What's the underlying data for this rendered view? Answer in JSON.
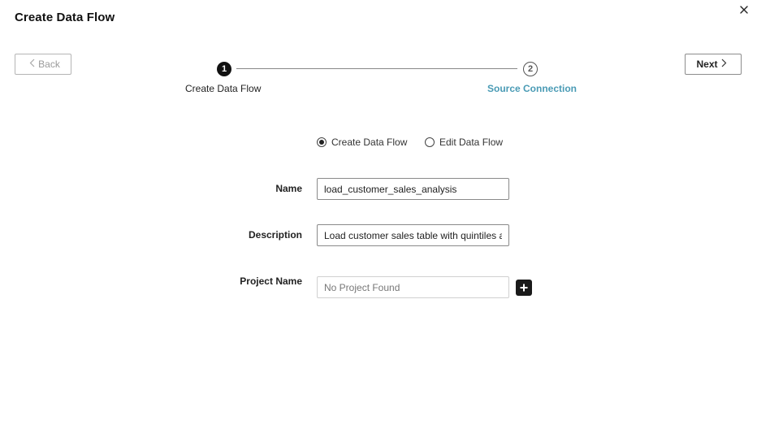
{
  "dialog": {
    "title": "Create Data Flow",
    "close_icon": "close-icon"
  },
  "nav": {
    "back_label": "Back",
    "next_label": "Next"
  },
  "stepper": {
    "steps": [
      {
        "number": "1",
        "label": "Create Data Flow",
        "state": "active"
      },
      {
        "number": "2",
        "label": "Source Connection",
        "state": "upcoming"
      }
    ],
    "upcoming_color": "#4a9bb5"
  },
  "mode": {
    "options": [
      {
        "label": "Create Data Flow",
        "selected": true
      },
      {
        "label": "Edit Data Flow",
        "selected": false
      }
    ]
  },
  "form": {
    "name_label": "Name",
    "name_value": "load_customer_sales_analysis",
    "description_label": "Description",
    "description_value": "Load customer sales table with quintiles and",
    "project_label": "Project Name",
    "project_placeholder": "No Project Found",
    "project_value": ""
  }
}
